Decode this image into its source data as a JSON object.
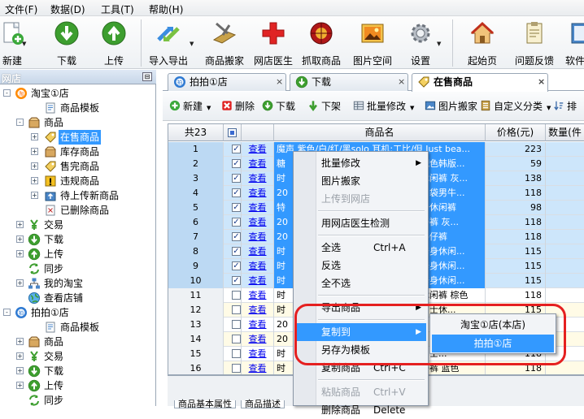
{
  "menu": [
    "文件(F)",
    "数据(D)",
    "工具(T)",
    "帮助(H)"
  ],
  "toolbar": [
    {
      "label": "新建",
      "icon": "new-doc-icon"
    },
    {
      "label": "下载",
      "icon": "download-icon"
    },
    {
      "label": "上传",
      "icon": "upload-icon"
    },
    {
      "label": "导入导出",
      "icon": "import-export-icon"
    },
    {
      "label": "商品搬家",
      "icon": "move-goods-icon"
    },
    {
      "label": "网店医生",
      "icon": "red-cross-icon"
    },
    {
      "label": "抓取商品",
      "icon": "capture-icon"
    },
    {
      "label": "图片空间",
      "icon": "picture-icon"
    },
    {
      "label": "设置",
      "icon": "gear-icon"
    },
    {
      "label": "起始页",
      "icon": "home-icon"
    },
    {
      "label": "问题反馈",
      "icon": "feedback-icon"
    },
    {
      "label": "软件帮",
      "icon": "help-icon"
    }
  ],
  "sidebar": {
    "title": "网店",
    "tree": [
      {
        "label": "淘宝①店",
        "level": 0,
        "icon": "taobao-icon",
        "exp": "-"
      },
      {
        "label": "商品模板",
        "level": 2,
        "icon": "template-icon"
      },
      {
        "label": "商品",
        "level": 1,
        "icon": "box-icon",
        "exp": "-"
      },
      {
        "label": "在售商品",
        "level": 2,
        "icon": "tag-icon",
        "exp": "+",
        "selected": true
      },
      {
        "label": "库存商品",
        "level": 2,
        "icon": "box-icon",
        "exp": "+"
      },
      {
        "label": "售完商品",
        "level": 2,
        "icon": "tag-icon",
        "exp": "+"
      },
      {
        "label": "违规商品",
        "level": 2,
        "icon": "warning-icon",
        "exp": "+"
      },
      {
        "label": "待上传新商品",
        "level": 2,
        "icon": "upload-pending-icon",
        "exp": "+"
      },
      {
        "label": "已删除商品",
        "level": 2,
        "icon": "deleted-icon"
      },
      {
        "label": "交易",
        "level": 1,
        "icon": "yen-icon",
        "exp": "+"
      },
      {
        "label": "下载",
        "level": 1,
        "icon": "download-icon",
        "exp": "+"
      },
      {
        "label": "上传",
        "level": 1,
        "icon": "upload-icon",
        "exp": "+"
      },
      {
        "label": "同步",
        "level": 1,
        "icon": "sync-icon"
      },
      {
        "label": "我的淘宝",
        "level": 1,
        "icon": "network-icon",
        "exp": "+"
      },
      {
        "label": "查看店铺",
        "level": 1,
        "icon": "globe-icon"
      },
      {
        "label": "拍拍①店",
        "level": 0,
        "icon": "paipai-icon",
        "exp": "-"
      },
      {
        "label": "商品模板",
        "level": 2,
        "icon": "template-icon"
      },
      {
        "label": "商品",
        "level": 1,
        "icon": "box-icon",
        "exp": "+"
      },
      {
        "label": "交易",
        "level": 1,
        "icon": "yen-icon",
        "exp": "+"
      },
      {
        "label": "下载",
        "level": 1,
        "icon": "download-icon",
        "exp": "+"
      },
      {
        "label": "上传",
        "level": 1,
        "icon": "upload-icon",
        "exp": "+"
      },
      {
        "label": "同步",
        "level": 1,
        "icon": "sync-icon"
      }
    ]
  },
  "tabs": [
    {
      "label": "拍拍①店",
      "close": "×"
    },
    {
      "label": "下载",
      "close": "×"
    },
    {
      "label": "在售商品",
      "close": "×",
      "active": true
    }
  ],
  "subtoolbar": [
    {
      "label": "新建",
      "icon": "plus-icon",
      "dd": "▼"
    },
    {
      "label": "删除",
      "icon": "delete-icon"
    },
    {
      "label": "下载",
      "icon": "download-icon"
    },
    {
      "label": "下架",
      "icon": "down-arrow-icon"
    },
    {
      "label": "批量修改",
      "icon": "batch-edit-icon",
      "dd": "▼"
    },
    {
      "label": "图片搬家",
      "icon": "picture-move-icon"
    },
    {
      "label": "自定义分类",
      "icon": "category-icon",
      "dd": "▼"
    },
    {
      "label": "排",
      "icon": "sort-icon"
    }
  ],
  "grid": {
    "count_label": "共23",
    "columns": [
      "商品名",
      "价格(元)",
      "数量(件"
    ],
    "rows": [
      {
        "n": "1",
        "checked": true,
        "view": "查看",
        "name": "魔声 紫色/白/红/黑solo 耳机:工比/但 Just bea...",
        "price": "223",
        "sel": true
      },
      {
        "n": "2",
        "checked": true,
        "view": "查看",
        "name": "糖",
        "name2": "配色韩版...",
        "price": "59",
        "sel": true
      },
      {
        "n": "3",
        "checked": true,
        "view": "查看",
        "name": "时",
        "name2": "休闲裤 灰...",
        "price": "138",
        "sel": true
      },
      {
        "n": "4",
        "checked": true,
        "view": "查看",
        "name": "20",
        "name2": "口袋男牛...",
        "price": "118",
        "sel": true
      },
      {
        "n": "5",
        "checked": true,
        "view": "查看",
        "name": "特",
        "name2": "务休闲裤",
        "price": "98",
        "sel": true
      },
      {
        "n": "6",
        "checked": true,
        "view": "查看",
        "name": "20",
        "name2": "仔裤 灰...",
        "price": "118",
        "sel": true
      },
      {
        "n": "7",
        "checked": true,
        "view": "查看",
        "name": "20",
        "name2": "牛仔裤",
        "price": "118",
        "sel": true
      },
      {
        "n": "8",
        "checked": true,
        "view": "查看",
        "name": "时",
        "name2": "修身休闲...",
        "price": "115",
        "sel": true
      },
      {
        "n": "9",
        "checked": true,
        "view": "查看",
        "name": "时",
        "name2": "修身休闲...",
        "price": "115",
        "sel": true
      },
      {
        "n": "10",
        "checked": true,
        "view": "查看",
        "name": "时",
        "name2": "修身休闲...",
        "price": "115",
        "sel": true,
        "current": true
      },
      {
        "n": "11",
        "checked": false,
        "view": "查看",
        "name": "时",
        "name2": "休闲裤 棕色",
        "price": "118"
      },
      {
        "n": "12",
        "checked": false,
        "view": "查看",
        "name": "时",
        "name2": "男士休...",
        "price": "115"
      },
      {
        "n": "13",
        "checked": false,
        "view": "查看",
        "name": "20",
        "name2": "",
        "price": "115"
      },
      {
        "n": "14",
        "checked": false,
        "view": "查看",
        "name": "20",
        "name2": "",
        "price": "118"
      },
      {
        "n": "15",
        "checked": false,
        "view": "查看",
        "name": "时",
        "name2": "男士...",
        "price": "118"
      },
      {
        "n": "16",
        "checked": false,
        "view": "查看",
        "name": "时",
        "name2": "仔裤 蓝色",
        "price": "118"
      }
    ]
  },
  "bottom_tabs": [
    "商品基本属性",
    "商品描述"
  ],
  "context_menu": [
    {
      "label": "批量修改",
      "arrow": "▶"
    },
    {
      "label": "图片搬家"
    },
    {
      "label": "上传到网店",
      "disabled": true
    },
    {
      "sep": true
    },
    {
      "label": "用网店医生检测"
    },
    {
      "sep": true
    },
    {
      "label": "全选",
      "key": "Ctrl+A"
    },
    {
      "label": "反选"
    },
    {
      "label": "全不选"
    },
    {
      "sep": true
    },
    {
      "label": "导出商品",
      "arrow": "▶"
    },
    {
      "sep": true
    },
    {
      "label": "复制到",
      "arrow": "▶",
      "highlight": true
    },
    {
      "label": "另存为模板"
    },
    {
      "label": "复制商品",
      "key": "Ctrl+C"
    },
    {
      "sep": true
    },
    {
      "label": "粘贴商品",
      "key": "Ctrl+V",
      "disabled": true
    },
    {
      "label": "删除商品",
      "key": "Delete"
    }
  ],
  "submenu": [
    {
      "label": "淘宝①店(本店)"
    },
    {
      "label": "拍拍①店",
      "highlight": true
    }
  ],
  "colors": {
    "selection": "#3399ff",
    "annotation_ring": "#e52020",
    "row_selected": "#cde6fb"
  }
}
